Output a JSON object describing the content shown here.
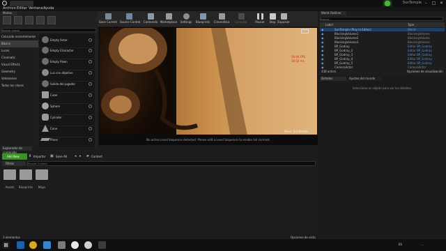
{
  "window": {
    "project_name": "SunTemple",
    "min": "–",
    "max": "□",
    "close": "✕"
  },
  "menu": [
    "Archivo",
    "Editar",
    "Ventana",
    "Ayuda"
  ],
  "modes": {
    "tab": "Modos",
    "search_placeholder": "Buscar clases",
    "categories": [
      "Colocado recientemente",
      "Básico",
      "Luces",
      "Cinematic",
      "Visual Effects",
      "Geometry",
      "Volúmenes",
      "Todas las clases"
    ],
    "actors": [
      "Empty Actor",
      "Empty Character",
      "Empty Pawn",
      "Luz con objetivo",
      "Salida del jugador",
      "Cube",
      "Sphere",
      "Cylinder",
      "Cone",
      "Plane"
    ]
  },
  "toolbar": {
    "buttons": [
      "Save Current",
      "Source Control",
      "Contenido",
      "Marketplace",
      "Settings",
      "Blueprints",
      "Cinemática",
      "Compilar",
      "Pausar",
      "Stop",
      "Expulsar"
    ]
  },
  "viewport": {
    "stats": [
      "56.94 FPS",
      "18.02 ms"
    ],
    "level_label": "Nivel: SunTemple",
    "message": "No active Level Sequence detected. Please edit a Level Sequence to enable full controls."
  },
  "outliner": {
    "tab": "World Outliner",
    "search_placeholder": "Buscar...",
    "col_label": "Label",
    "col_type": "Type",
    "rows": [
      {
        "label": "SunTemple (Play In Editor)",
        "type": "World"
      },
      {
        "label": "BlockingVolume1",
        "type": "BlockingVolume"
      },
      {
        "label": "BlockingVolume2",
        "type": "BlockingVolume"
      },
      {
        "label": "BlockingVolume3",
        "type": "BlockingVolume"
      },
      {
        "label": "BP_Godray",
        "type": "Editar BP_Godray"
      },
      {
        "label": "BP_Godray_2",
        "type": "Editar BP_Godray"
      },
      {
        "label": "BP_Godray_3",
        "type": "Editar BP_Godray"
      },
      {
        "label": "BP_Godray_4",
        "type": "Editar BP_Godray"
      },
      {
        "label": "BP_Godray_5",
        "type": "Editar BP_Godray"
      },
      {
        "label": "CameraActor",
        "type": "CameraActor"
      }
    ],
    "count": "438 actors",
    "view_options": "Opciones de visualización"
  },
  "details": {
    "tabs": [
      "Detalles",
      "Ajustes del mundo"
    ],
    "empty_message": "Seleccione un objeto para ver los detalles."
  },
  "content_browser": {
    "tab": "Explorador de contenido",
    "add_new": "Add New",
    "import": "Importar",
    "save_all": "Save All",
    "path": "Content",
    "filters": "Filtros",
    "search_placeholder": "Buscar Content",
    "folders": [
      "Assets",
      "Blueprints",
      "Maps"
    ],
    "item_count": "3 elementos",
    "view_options": "Opciones de vista"
  },
  "taskbar": {
    "tray": "ES",
    "time": "..."
  }
}
